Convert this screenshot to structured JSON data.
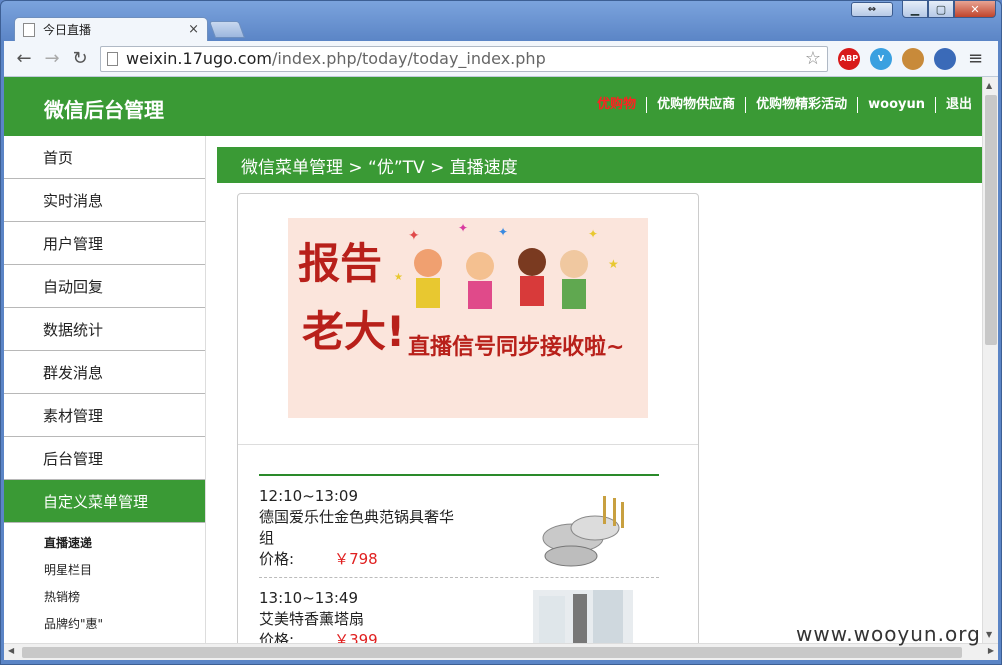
{
  "browser": {
    "tab_title": "今日直播",
    "url_host": "weixin.17ugo.com",
    "url_path": "/index.php/today/today_index.php",
    "extensions": [
      {
        "name": "adblock-plus-icon",
        "label": "ABP",
        "color": "#d81a1a"
      },
      {
        "name": "vivaldi-v-icon",
        "label": "V",
        "color": "#3aa0e0"
      },
      {
        "name": "cookie-icon",
        "label": "",
        "color": "#c88a3a"
      },
      {
        "name": "globe-icon",
        "label": "",
        "color": "#3a6ab8"
      }
    ]
  },
  "header": {
    "title": "微信后台管理",
    "nav": [
      "优购物",
      "优购物供应商",
      "优购物精彩活动",
      "wooyun",
      "退出"
    ]
  },
  "sidebar": {
    "items": [
      "首页",
      "实时消息",
      "用户管理",
      "自动回复",
      "数据统计",
      "群发消息",
      "素材管理",
      "后台管理",
      "自定义菜单管理"
    ],
    "active_index": 8,
    "subitems": [
      "直播速递",
      "明星栏目",
      "热销榜",
      "品牌约\"惠\""
    ]
  },
  "breadcrumb": "微信菜单管理 >  “优”TV > 直播速度",
  "banner": {
    "line1": "报告",
    "line2": "老大!",
    "line3": "直播信号同步接收啦~"
  },
  "products": [
    {
      "time": "12:10~13:09",
      "name": "德国爱乐仕金色典范锅具奢华组",
      "price_label": "价格:",
      "price": "￥798"
    },
    {
      "time": "13:10~13:49",
      "name": "艾美特香薰塔扇",
      "price_label": "价格:",
      "price": "￥399"
    }
  ],
  "watermark": "www.wooyun.org",
  "colors": {
    "accent": "#3a9a35",
    "price": "#e02020",
    "nav_highlight": "#ff2020"
  }
}
